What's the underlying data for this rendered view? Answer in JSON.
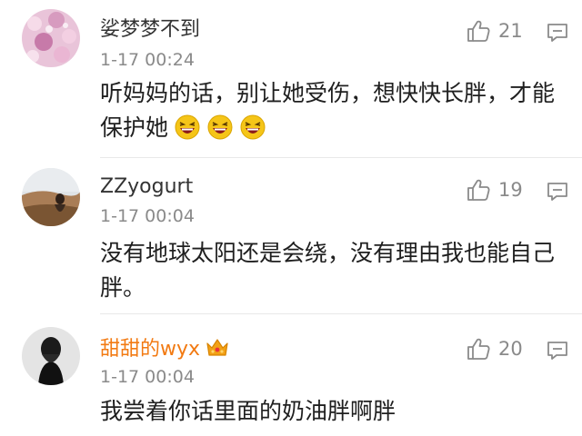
{
  "comments": [
    {
      "username": "娑梦梦不到",
      "time": "1-17 00:24",
      "likes": "21",
      "text": "听妈妈的话，别让她受伤，想快快长胖，才能保护她",
      "avatar_icon": "pink-blossom-avatar",
      "emoji_count": 3,
      "emoji_icon": "laughing-face-emoji"
    },
    {
      "username": "ZZyogurt",
      "time": "1-17 00:04",
      "likes": "19",
      "text": "没有地球太阳还是会绕，没有理由我也能自己胖。",
      "avatar_icon": "landscape-photo-avatar"
    },
    {
      "username": "甜甜的wyx",
      "time": "1-17 00:04",
      "likes": "20",
      "text": "我尝着你话里面的奶油胖啊胖",
      "avatar_icon": "dark-portrait-avatar",
      "badge_icon": "crown-icon"
    }
  ],
  "colors": {
    "vip_name": "#f27a12",
    "meta_gray": "#8a8a8a"
  }
}
